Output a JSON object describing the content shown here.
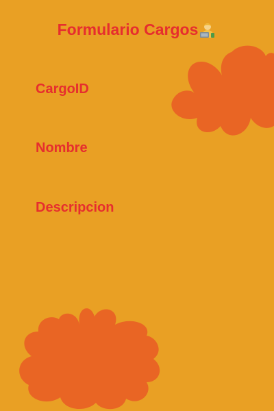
{
  "form": {
    "title": "Formulario Cargos",
    "title_icon": "office-worker-icon",
    "fields": [
      {
        "label": "CargoID"
      },
      {
        "label": "Nombre"
      },
      {
        "label": "Descripcion"
      }
    ]
  },
  "colors": {
    "background": "#E9A024",
    "decor_blob": "#E96524",
    "text": "#E62E2E"
  }
}
